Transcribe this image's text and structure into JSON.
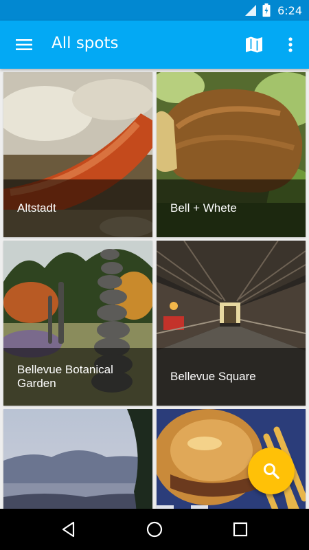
{
  "status_bar": {
    "time": "6:24",
    "color": "#0288d1"
  },
  "app_bar": {
    "title": "All spots",
    "color": "#03a9f4",
    "icons": [
      "menu-icon",
      "map-icon",
      "more-vert-icon"
    ]
  },
  "spots": [
    {
      "label": "Altstadt",
      "image": "sausage with sauerkraut"
    },
    {
      "label": "Bell + Whete",
      "image": "roasted pork knuckle"
    },
    {
      "label": "Bellevue Botanical Garden",
      "image": "stacked stone sculpture in garden"
    },
    {
      "label": "Bellevue Square",
      "image": "covered pedestrian skybridge"
    },
    {
      "label": "",
      "image": "mountain view at dusk"
    },
    {
      "label": "",
      "image": "burger and fries"
    }
  ],
  "fab": {
    "icon": "search-icon",
    "color": "#ffc107"
  },
  "nav_bar": {
    "icons": [
      "back-icon",
      "home-icon",
      "recents-icon"
    ]
  }
}
